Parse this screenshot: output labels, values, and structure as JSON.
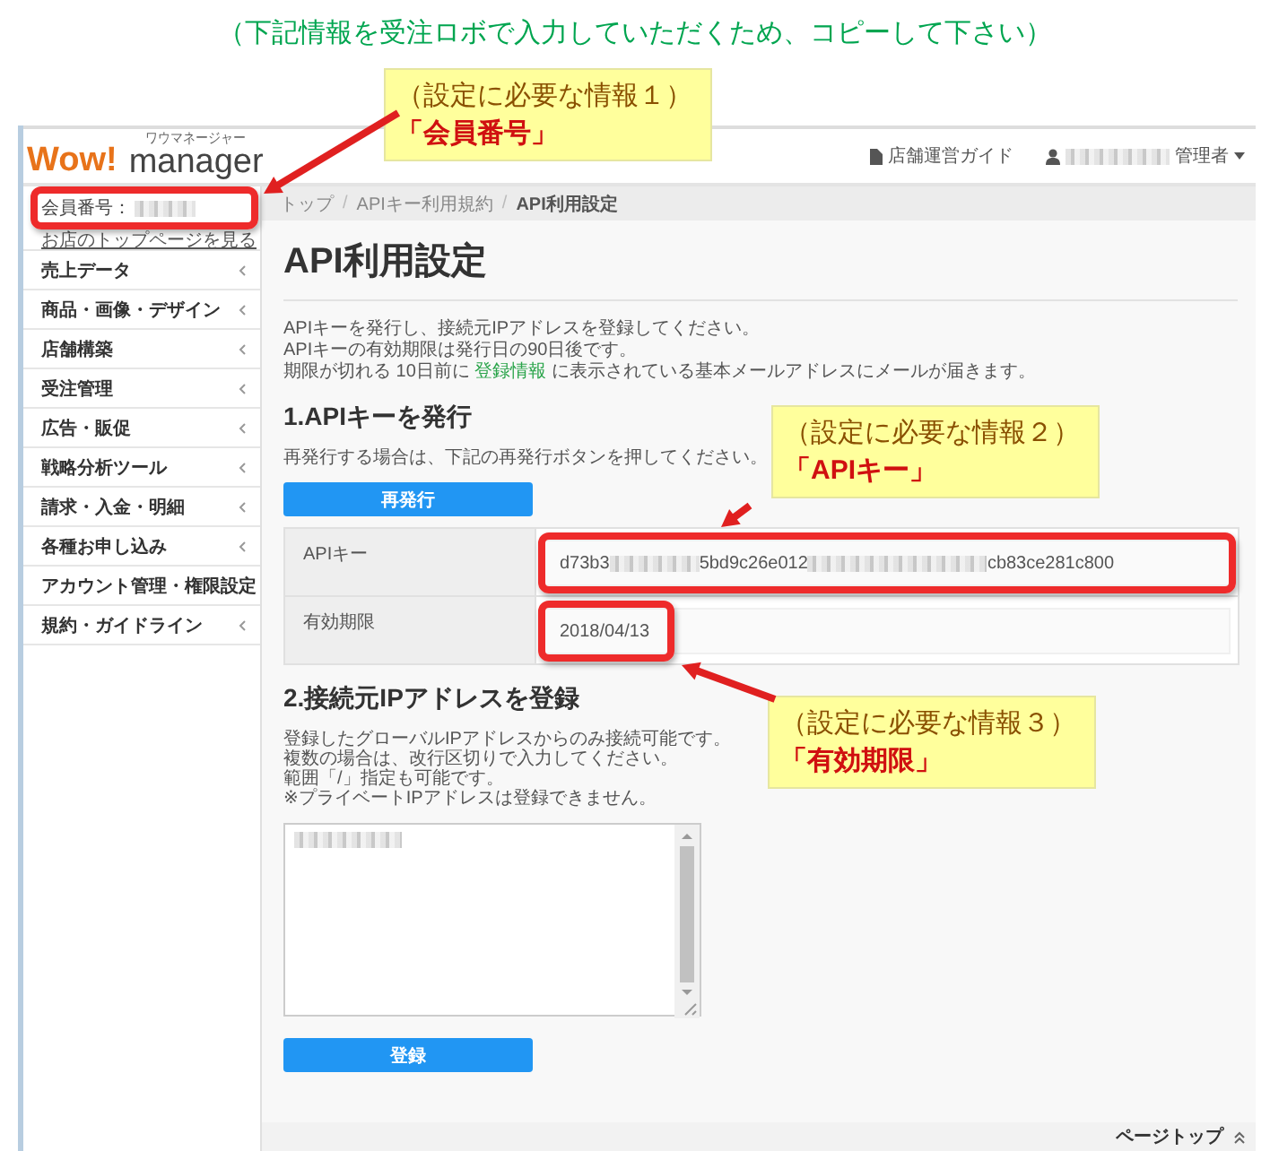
{
  "caption": "（下記情報を受注ロボで入力していただくため、コピーして下さい）",
  "header": {
    "logo_main": "Wow!",
    "logo_sub": "manager",
    "logo_ruby": "ワウマネージャー",
    "guide_link": "店舗運営ガイド",
    "user_suffix": "管理者"
  },
  "sidebar": {
    "member_label": "会員番号：",
    "shop_link": "お店のトップページを見る",
    "items": [
      {
        "label": "売上データ"
      },
      {
        "label": "商品・画像・デザイン"
      },
      {
        "label": "店舗構築"
      },
      {
        "label": "受注管理"
      },
      {
        "label": "広告・販促"
      },
      {
        "label": "戦略分析ツール"
      },
      {
        "label": "請求・入金・明細"
      },
      {
        "label": "各種お申し込み"
      },
      {
        "label": "アカウント管理・権限設定"
      },
      {
        "label": "規約・ガイドライン"
      }
    ]
  },
  "breadcrumb": [
    "トップ",
    "APIキー利用規約",
    "API利用設定"
  ],
  "breadcrumb_separator": "/",
  "page_title": "API利用設定",
  "intro": [
    "APIキーを発行し、接続元IPアドレスを登録してください。",
    "APIキーの有効期限は発行日の90日後です。"
  ],
  "intro_notice": {
    "before": "期限が切れる 10日前に ",
    "link": "登録情報",
    "after": " に表示されている基本メールアドレスにメールが届きます。"
  },
  "section1": {
    "heading": "1.APIキーを発行",
    "note": "再発行する場合は、下記の再発行ボタンを押してください。",
    "button": "再発行",
    "rows": [
      {
        "label": "APIキー",
        "value_parts": [
          "d73b3",
          "5bd9c26e012",
          "cb83ce281c800"
        ]
      },
      {
        "label": "有効期限",
        "value_parts": [
          "2018/04/13"
        ]
      }
    ]
  },
  "section2": {
    "heading": "2.接続元IPアドレスを登録",
    "notes": [
      "登録したグローバルIPアドレスからのみ接続可能です。",
      "複数の場合は、改行区切りで入力してください。",
      "範囲「/」指定も可能です。",
      "※プライベートIPアドレスは登録できません。"
    ],
    "button": "登録"
  },
  "footer": {
    "page_top": "ページトップ"
  },
  "annotations": [
    {
      "title": "（設定に必要な情報１）",
      "label": "「会員番号」"
    },
    {
      "title": "（設定に必要な情報２）",
      "label": "「APIキー」"
    },
    {
      "title": "（設定に必要な情報３）",
      "label": "「有効期限」"
    }
  ]
}
